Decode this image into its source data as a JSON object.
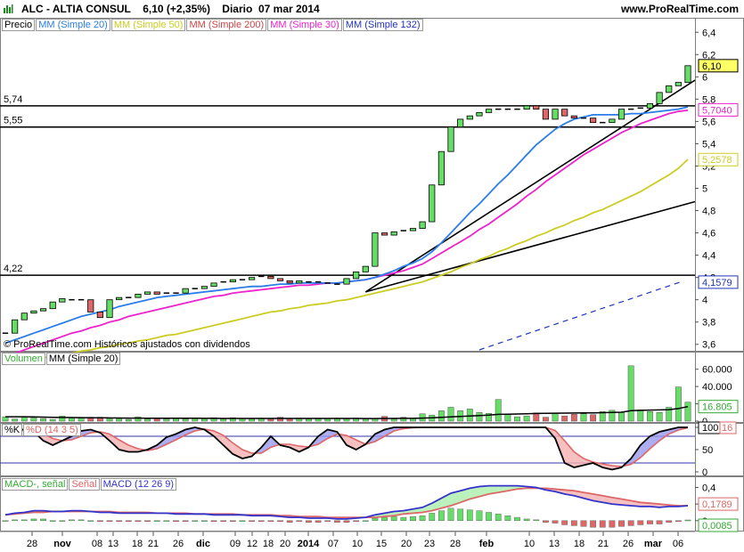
{
  "header": {
    "ticker": "ALC - ALTIA CONSUL",
    "price": "6,10 (+2,35%)",
    "period": "Diario",
    "date": "07 mar 2014",
    "site": "www.ProRealTime.com"
  },
  "copyright": "© ProRealTime.com Históricos ajustados con dividendos",
  "colors": {
    "up": "#66dd66",
    "down": "#dd6666",
    "ma20": "#2b7de9",
    "ma50": "#cccc22",
    "ma200": "#cc4444",
    "ma30": "#ee22cc",
    "ma132": "#2233bb",
    "k": "#000000",
    "d": "#dd6666",
    "macd": "#3333cc",
    "signal": "#dd6666"
  },
  "legends": {
    "price": [
      "Precio",
      "MM (Simple 20)",
      "MM (Simple 50)",
      "MM (Simple 200)",
      "MM (Simple 30)",
      "MM (Simple 132)"
    ],
    "volume": [
      "Volumen",
      "MM (Simple 20)"
    ],
    "stoch": [
      "%K",
      "%D (14 3 5)"
    ],
    "macd": [
      "MACD-, señal",
      "Señal",
      "MACD (12 26 9)"
    ]
  },
  "x_labels": [
    "28",
    "nov",
    "08",
    "13",
    "18",
    "21",
    "26",
    "dic",
    "09",
    "12",
    "18",
    "20",
    "2014",
    "07",
    "10",
    "15",
    "20",
    "23",
    "28",
    "feb",
    "10",
    "13",
    "18",
    "21",
    "26",
    "mar",
    "06"
  ],
  "chart_data": [
    {
      "type": "candlestick",
      "title": "ALC - ALTIA CONSUL",
      "ylim": [
        3.55,
        6.45
      ],
      "y_ticks": [
        "3,6",
        "3,8",
        "4",
        "4,2",
        "4,4",
        "4,6",
        "4,8",
        "5",
        "5,2",
        "5,4",
        "5,6",
        "5,8",
        "6",
        "6,2",
        "6,4"
      ],
      "horizontal_lines": [
        {
          "label": "5,74",
          "value": 5.74
        },
        {
          "label": "5,55",
          "value": 5.55
        },
        {
          "label": "4,22",
          "value": 4.22
        }
      ],
      "value_tags": [
        {
          "label": "6,10",
          "value": 6.1,
          "color": "#000000",
          "bg": "#ffff66"
        },
        {
          "label": "5,7040",
          "value": 5.704,
          "color": "#ee22cc"
        },
        {
          "label": "5,2578",
          "value": 5.2578,
          "color": "#cccc22"
        },
        {
          "label": "4,1579",
          "value": 4.1579,
          "color": "#2233bb"
        }
      ],
      "closes": [
        3.7,
        3.82,
        3.88,
        3.9,
        3.92,
        3.98,
        4.01,
        4.0,
        4.0,
        3.89,
        3.84,
        4.0,
        4.02,
        4.02,
        4.05,
        4.07,
        4.05,
        4.06,
        4.06,
        4.1,
        4.1,
        4.12,
        4.15,
        4.16,
        4.18,
        4.18,
        4.2,
        4.21,
        4.19,
        4.17,
        4.15,
        4.17,
        4.16,
        4.16,
        4.15,
        4.14,
        4.19,
        4.25,
        4.3,
        4.6,
        4.58,
        4.61,
        4.62,
        4.64,
        4.7,
        5.03,
        5.33,
        5.55,
        5.62,
        5.65,
        5.68,
        5.71,
        5.71,
        5.71,
        5.71,
        5.74,
        5.71,
        5.62,
        5.71,
        5.65,
        5.63,
        5.63,
        5.59,
        5.59,
        5.62,
        5.71,
        5.71,
        5.72,
        5.76,
        5.86,
        5.92,
        5.95,
        6.1
      ],
      "ma20": [
        3.61,
        3.64,
        3.67,
        3.7,
        3.73,
        3.76,
        3.79,
        3.82,
        3.85,
        3.87,
        3.89,
        3.91,
        3.94,
        3.96,
        3.98,
        4.0,
        4.02,
        4.03,
        4.04,
        4.05,
        4.06,
        4.07,
        4.08,
        4.09,
        4.1,
        4.11,
        4.12,
        4.12,
        4.13,
        4.14,
        4.14,
        4.15,
        4.15,
        4.15,
        4.15,
        4.15,
        4.16,
        4.17,
        4.18,
        4.2,
        4.23,
        4.26,
        4.3,
        4.33,
        4.37,
        4.43,
        4.51,
        4.6,
        4.69,
        4.78,
        4.86,
        4.95,
        5.04,
        5.12,
        5.21,
        5.3,
        5.39,
        5.46,
        5.53,
        5.58,
        5.62,
        5.64,
        5.66,
        5.66,
        5.66,
        5.66,
        5.67,
        5.67,
        5.68,
        5.69,
        5.7,
        5.71,
        5.73
      ],
      "ma50": [
        3.42,
        3.43,
        3.45,
        3.46,
        3.48,
        3.49,
        3.51,
        3.52,
        3.54,
        3.55,
        3.57,
        3.58,
        3.6,
        3.61,
        3.63,
        3.64,
        3.66,
        3.68,
        3.69,
        3.71,
        3.73,
        3.75,
        3.77,
        3.79,
        3.81,
        3.83,
        3.85,
        3.87,
        3.89,
        3.9,
        3.92,
        3.93,
        3.95,
        3.96,
        3.97,
        3.99,
        4.0,
        4.02,
        4.04,
        4.06,
        4.08,
        4.1,
        4.12,
        4.14,
        4.16,
        4.19,
        4.22,
        4.25,
        4.29,
        4.32,
        4.36,
        4.39,
        4.43,
        4.46,
        4.5,
        4.53,
        4.57,
        4.6,
        4.64,
        4.67,
        4.71,
        4.74,
        4.78,
        4.81,
        4.85,
        4.89,
        4.93,
        4.97,
        5.02,
        5.07,
        5.12,
        5.18,
        5.26
      ],
      "ma30": [
        3.49,
        3.52,
        3.55,
        3.58,
        3.61,
        3.64,
        3.67,
        3.7,
        3.72,
        3.75,
        3.77,
        3.8,
        3.82,
        3.85,
        3.87,
        3.89,
        3.91,
        3.93,
        3.95,
        3.97,
        3.99,
        4.01,
        4.03,
        4.04,
        4.06,
        4.07,
        4.08,
        4.09,
        4.1,
        4.11,
        4.12,
        4.13,
        4.13,
        4.14,
        4.15,
        4.15,
        4.16,
        4.17,
        4.18,
        4.2,
        4.22,
        4.24,
        4.26,
        4.29,
        4.32,
        4.37,
        4.42,
        4.47,
        4.52,
        4.57,
        4.63,
        4.68,
        4.74,
        4.8,
        4.86,
        4.93,
        4.99,
        5.06,
        5.12,
        5.18,
        5.24,
        5.3,
        5.35,
        5.4,
        5.45,
        5.5,
        5.54,
        5.58,
        5.61,
        5.64,
        5.67,
        5.69,
        5.7
      ],
      "ma132_segment": {
        "x_start_index": 50,
        "values": [
          3.55,
          4.16
        ]
      }
    },
    {
      "type": "bar",
      "title": "Volumen",
      "ylim": [
        0,
        70000
      ],
      "y_ticks": [
        "0",
        "20.000",
        "40.000",
        "60.000"
      ],
      "value_tag": "16.805",
      "values": [
        5000,
        2500,
        4500,
        4000,
        3000,
        2000,
        6000,
        4000,
        3500,
        4500,
        4500,
        3000,
        3000,
        2000,
        5000,
        2500,
        3000,
        2500,
        3500,
        2500,
        3000,
        3000,
        4000,
        2500,
        4000,
        3000,
        2500,
        3500,
        2500,
        4500,
        3000,
        3500,
        2500,
        3500,
        3000,
        3500,
        2500,
        3500,
        2500,
        3000,
        5500,
        2500,
        4500,
        3000,
        8500,
        7000,
        12000,
        16000,
        12000,
        14000,
        10000,
        9000,
        25000,
        8000,
        5000,
        6000,
        9500,
        4500,
        9000,
        6000,
        8000,
        8500,
        7500,
        11000,
        12500,
        10000,
        64000,
        13000,
        11000,
        10000,
        16000,
        39500,
        22000
      ],
      "ma20": [
        5000,
        5000,
        5000,
        4800,
        4600,
        4400,
        4200,
        4100,
        4000,
        3900,
        3800,
        3700,
        3600,
        3500,
        3500,
        3400,
        3400,
        3300,
        3300,
        3300,
        3300,
        3200,
        3200,
        3100,
        3100,
        3100,
        3100,
        3100,
        3100,
        3100,
        3100,
        3100,
        3100,
        3100,
        3100,
        3100,
        3100,
        3100,
        3000,
        3000,
        3100,
        3100,
        3200,
        3200,
        3500,
        3800,
        4300,
        4900,
        5400,
        6000,
        6500,
        7000,
        7800,
        8000,
        8200,
        8500,
        8900,
        9000,
        9200,
        9300,
        9400,
        9500,
        9600,
        9800,
        10000,
        10300,
        12000,
        12500,
        12800,
        13000,
        13300,
        14500,
        16805
      ]
    },
    {
      "type": "line",
      "title": "%K %D (14 3 5)",
      "ylim": [
        0,
        100
      ],
      "y_ticks": [
        "0",
        "50",
        "100"
      ],
      "value_tags": [
        "100",
        "16"
      ],
      "k": [
        95,
        95,
        95,
        90,
        70,
        60,
        70,
        80,
        92,
        95,
        88,
        70,
        50,
        45,
        45,
        50,
        60,
        78,
        85,
        95,
        100,
        95,
        80,
        60,
        40,
        30,
        35,
        55,
        80,
        60,
        55,
        45,
        55,
        80,
        95,
        90,
        60,
        50,
        62,
        85,
        95,
        100,
        100,
        100,
        100,
        100,
        100,
        100,
        100,
        100,
        100,
        100,
        100,
        100,
        100,
        100,
        100,
        100,
        75,
        20,
        10,
        15,
        20,
        10,
        5,
        10,
        30,
        60,
        80,
        90,
        95,
        100,
        100
      ],
      "d": [
        90,
        92,
        93,
        92,
        85,
        75,
        70,
        72,
        80,
        88,
        90,
        85,
        72,
        60,
        52,
        48,
        52,
        62,
        72,
        83,
        92,
        96,
        92,
        82,
        65,
        50,
        42,
        42,
        55,
        62,
        62,
        58,
        56,
        62,
        75,
        85,
        82,
        72,
        62,
        68,
        80,
        92,
        97,
        99,
        100,
        100,
        100,
        100,
        100,
        100,
        100,
        100,
        100,
        100,
        100,
        100,
        100,
        100,
        93,
        70,
        45,
        30,
        22,
        18,
        14,
        12,
        17,
        32,
        52,
        70,
        85,
        94,
        99
      ]
    },
    {
      "type": "line",
      "title": "MACD (12 26 9)",
      "ylim": [
        -0.12,
        0.48
      ],
      "y_ticks": [
        "0",
        "0,2",
        "0,4"
      ],
      "value_tags": [
        "0,1789",
        "0,0085"
      ],
      "macd": [
        0.07,
        0.09,
        0.1,
        0.12,
        0.12,
        0.11,
        0.11,
        0.12,
        0.12,
        0.11,
        0.1,
        0.1,
        0.09,
        0.09,
        0.09,
        0.09,
        0.09,
        0.09,
        0.08,
        0.08,
        0.08,
        0.08,
        0.07,
        0.07,
        0.07,
        0.07,
        0.06,
        0.06,
        0.06,
        0.05,
        0.04,
        0.04,
        0.03,
        0.03,
        0.03,
        0.02,
        0.02,
        0.03,
        0.04,
        0.07,
        0.09,
        0.11,
        0.12,
        0.14,
        0.16,
        0.21,
        0.27,
        0.33,
        0.36,
        0.39,
        0.41,
        0.42,
        0.42,
        0.42,
        0.42,
        0.41,
        0.4,
        0.37,
        0.35,
        0.32,
        0.3,
        0.27,
        0.24,
        0.22,
        0.2,
        0.19,
        0.18,
        0.17,
        0.17,
        0.16,
        0.17,
        0.17,
        0.18
      ],
      "signal": [
        0.07,
        0.08,
        0.09,
        0.1,
        0.1,
        0.11,
        0.11,
        0.11,
        0.11,
        0.11,
        0.11,
        0.11,
        0.1,
        0.1,
        0.1,
        0.1,
        0.09,
        0.09,
        0.09,
        0.09,
        0.08,
        0.08,
        0.08,
        0.08,
        0.08,
        0.07,
        0.07,
        0.07,
        0.07,
        0.06,
        0.06,
        0.05,
        0.05,
        0.05,
        0.04,
        0.04,
        0.04,
        0.04,
        0.04,
        0.04,
        0.05,
        0.06,
        0.08,
        0.09,
        0.1,
        0.12,
        0.15,
        0.18,
        0.22,
        0.26,
        0.29,
        0.32,
        0.34,
        0.36,
        0.38,
        0.39,
        0.39,
        0.39,
        0.38,
        0.37,
        0.36,
        0.34,
        0.32,
        0.3,
        0.28,
        0.26,
        0.24,
        0.22,
        0.21,
        0.2,
        0.19,
        0.18,
        0.18
      ],
      "histogram": [
        0.0,
        0.01,
        0.01,
        0.02,
        0.02,
        0.0,
        0.0,
        0.01,
        0.01,
        0.0,
        -0.01,
        -0.01,
        -0.01,
        -0.01,
        -0.01,
        -0.01,
        0.0,
        0.0,
        -0.01,
        -0.01,
        0.0,
        0.0,
        -0.01,
        -0.01,
        -0.01,
        0.0,
        -0.01,
        -0.01,
        -0.01,
        -0.01,
        -0.02,
        -0.01,
        -0.02,
        -0.02,
        -0.01,
        -0.02,
        -0.02,
        -0.01,
        0.0,
        0.03,
        0.04,
        0.05,
        0.04,
        0.05,
        0.06,
        0.09,
        0.12,
        0.15,
        0.14,
        0.13,
        0.12,
        0.1,
        0.08,
        0.06,
        0.04,
        0.02,
        0.01,
        -0.02,
        -0.03,
        -0.05,
        -0.06,
        -0.07,
        -0.08,
        -0.08,
        -0.08,
        -0.07,
        -0.06,
        -0.05,
        -0.04,
        -0.04,
        -0.02,
        -0.01,
        0.0085
      ]
    }
  ]
}
